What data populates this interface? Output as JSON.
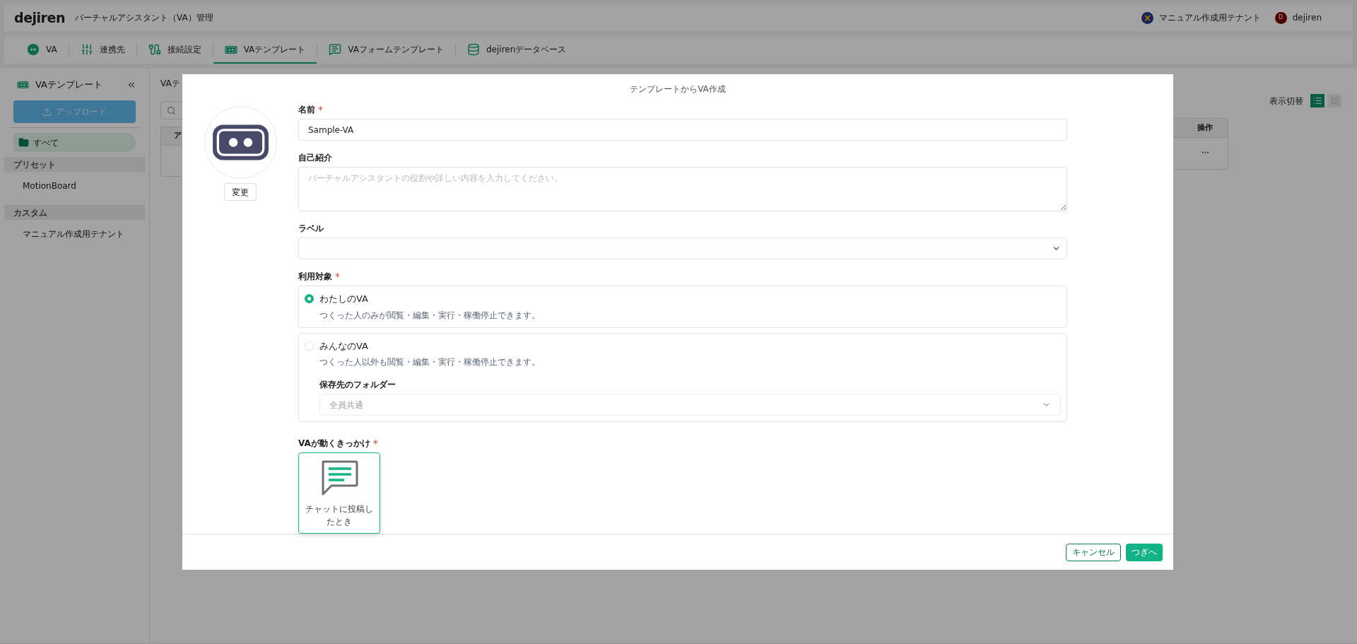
{
  "header": {
    "logo": "dejiren",
    "title": "バーチャルアシスタント（VA）管理",
    "tenant": "マニュアル作成用テナント",
    "user": {
      "initial": "D",
      "name": "dejiren"
    }
  },
  "nav_tabs": [
    {
      "label": "VA",
      "selected": false
    },
    {
      "label": "連携先",
      "selected": false
    },
    {
      "label": "接続設定",
      "selected": false
    },
    {
      "label": "VAテンプレート",
      "selected": true
    },
    {
      "label": "VAフォームテンプレート",
      "selected": false
    },
    {
      "label": "dejirenデータベース",
      "selected": false
    }
  ],
  "sidebar": {
    "title": "VAテンプレート",
    "upload_button": "アップロード",
    "items": [
      {
        "kind": "folder",
        "label": "すべて",
        "selected": true
      },
      {
        "kind": "section",
        "label": "プリセット"
      },
      {
        "kind": "item",
        "label": "MotionBoard",
        "selected": false
      },
      {
        "kind": "section",
        "label": "カスタム"
      },
      {
        "kind": "item",
        "label": "マニュアル作成用テナント",
        "selected": false
      }
    ]
  },
  "content": {
    "breadcrumb": "VAテ",
    "view_toggle": {
      "label": "表示切替",
      "views": [
        {
          "selected": true
        },
        {
          "selected": false
        }
      ]
    },
    "table": {
      "columns": [
        "ア",
        "操作"
      ],
      "rows": [
        {
          "actions": "•••"
        }
      ]
    }
  },
  "modal": {
    "title": "テンプレートからVA作成",
    "avatar_button": "変更",
    "name": {
      "label": "名前",
      "required_mark": "*",
      "value": "Sample-VA"
    },
    "intro": {
      "label": "自己紹介",
      "placeholder": "バーチャルアシスタントの役割や詳しい内容を入力してください。"
    },
    "label_select": {
      "label": "ラベル"
    },
    "audience": {
      "label": "利用対象",
      "required_mark": "*",
      "options": [
        {
          "title": "わたしのVA",
          "description": "つくった人のみが閲覧・編集・実行・稼働停止できます。",
          "selected": true
        },
        {
          "title": "みんなのVA",
          "description": "つくった人以外も閲覧・編集・実行・稼働停止できます。",
          "selected": false,
          "folder": {
            "label": "保存先のフォルダー",
            "value": "全員共通",
            "disabled": true
          }
        }
      ]
    },
    "trigger": {
      "label": "VAが動くきっかけ",
      "required_mark": "*",
      "options": [
        {
          "label": "チャットに投稿したとき",
          "selected": true
        }
      ]
    },
    "buttons": {
      "cancel": "キャンセル",
      "next": "つぎへ"
    }
  }
}
